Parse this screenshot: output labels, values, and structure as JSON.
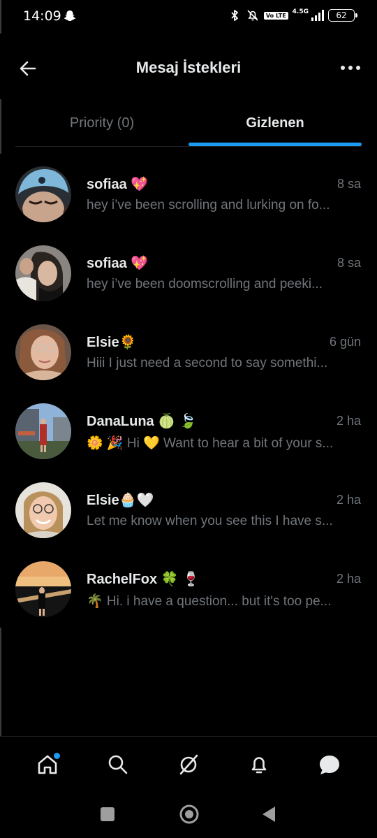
{
  "status_bar": {
    "time": "14:09",
    "network": "4.5G",
    "volte": "Vo LTE",
    "battery": "62"
  },
  "header": {
    "title": "Mesaj İstekleri"
  },
  "tabs": [
    {
      "label": "Priority (0)",
      "active": false
    },
    {
      "label": "Gizlenen",
      "active": true
    }
  ],
  "messages": [
    {
      "name": "sofiaa 💖",
      "time": "8 sa",
      "preview": "hey i’ve been scrolling and lurking on fo..."
    },
    {
      "name": "sofiaa 💖",
      "time": "8 sa",
      "preview": "hey i’ve been doomscrolling and peeki..."
    },
    {
      "name": "Elsie🌻",
      "time": "6 gün",
      "preview": "Hiii I just need a second to say somethi..."
    },
    {
      "name": "DanaLuna 🍈 🍃",
      "time": "2 ha",
      "preview": "🌼 🎉 Hi 💛 Want to hear a bit of your s..."
    },
    {
      "name": "Elsie🧁🤍",
      "time": "2 ha",
      "preview": "Let me know when you see this I have s..."
    },
    {
      "name": "RachelFox 🍀 🍷",
      "time": "2 ha",
      "preview": "🌴 Hi. i have a question... but it's too pe..."
    }
  ],
  "bottom_nav": [
    {
      "icon": "home-icon",
      "notification_dot": true
    },
    {
      "icon": "search-icon"
    },
    {
      "icon": "grok-icon"
    },
    {
      "icon": "bell-icon"
    },
    {
      "icon": "messages-icon"
    }
  ],
  "colors": {
    "background": "#000000",
    "accent": "#1d9bf0",
    "primary_text": "#e7e9ea",
    "secondary_text": "#71767b"
  }
}
